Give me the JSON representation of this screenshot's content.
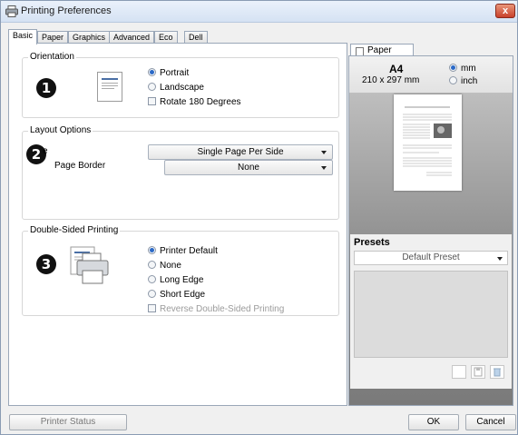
{
  "window": {
    "title": "Printing Preferences",
    "close_label": "x"
  },
  "tabs": [
    "Basic",
    "Paper",
    "Graphics",
    "Advanced",
    "Eco",
    "Dell"
  ],
  "orientation": {
    "label": "Orientation",
    "badge": "1",
    "options": [
      "Portrait",
      "Landscape"
    ],
    "selected": "Portrait",
    "rotate_label": "Rotate 180 Degrees"
  },
  "layout": {
    "label": "Layout Options",
    "badge": "2",
    "type_label": "e",
    "type_value": "Single Page Per Side",
    "border_label": "Page Border",
    "border_value": "None"
  },
  "duplex": {
    "label": "Double-Sided Printing",
    "badge": "3",
    "options": [
      "Printer Default",
      "None",
      "Long Edge",
      "Short Edge"
    ],
    "selected": "Printer Default",
    "reverse_label": "Reverse Double-Sided Printing"
  },
  "paper_panel": {
    "tab_label": "Paper",
    "size": "A4",
    "dims": "210 x 297 mm",
    "units": [
      "mm",
      "inch"
    ],
    "selected_unit": "mm"
  },
  "presets": {
    "title": "Presets",
    "value": "Default Preset"
  },
  "buttons": {
    "printer_status": "Printer Status",
    "ok": "OK",
    "cancel": "Cancel"
  }
}
